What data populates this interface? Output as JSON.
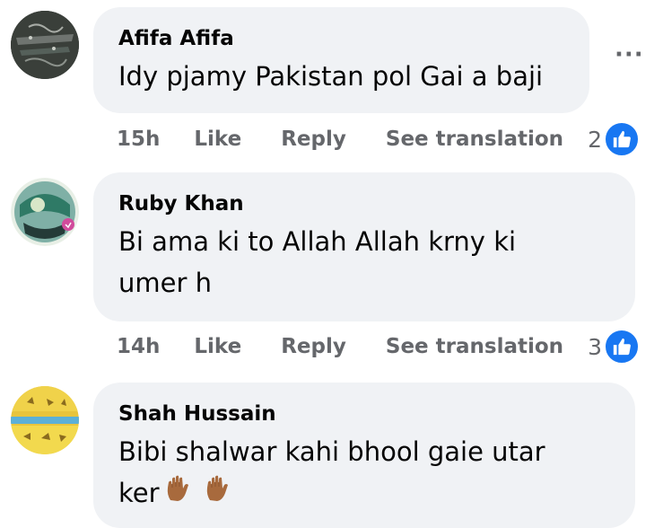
{
  "comments": [
    {
      "author": "Afifa Afifa",
      "text": "Idy pjamy Pakistan pol Gai a baji",
      "time": "15h",
      "like_label": "Like",
      "reply_label": "Reply",
      "translate_label": "See translation",
      "reaction_count": "2",
      "more_label": "···"
    },
    {
      "author": "Ruby Khan",
      "text_line1": "Bi ama ki to Allah Allah krny ki",
      "text_line2": "umer h",
      "time": "14h",
      "like_label": "Like",
      "reply_label": "Reply",
      "translate_label": "See translation",
      "reaction_count": "3"
    },
    {
      "author": "Shah Hussain",
      "text_line1": "Bibi shalwar kahi bhool gaie utar",
      "text_line2": "ker",
      "emoji": "raised-hand-medium-skin-tone x2"
    }
  ],
  "colors": {
    "bubble": "#f0f2f5",
    "meta_text": "#65676b",
    "like_blue": "#1877f2"
  }
}
